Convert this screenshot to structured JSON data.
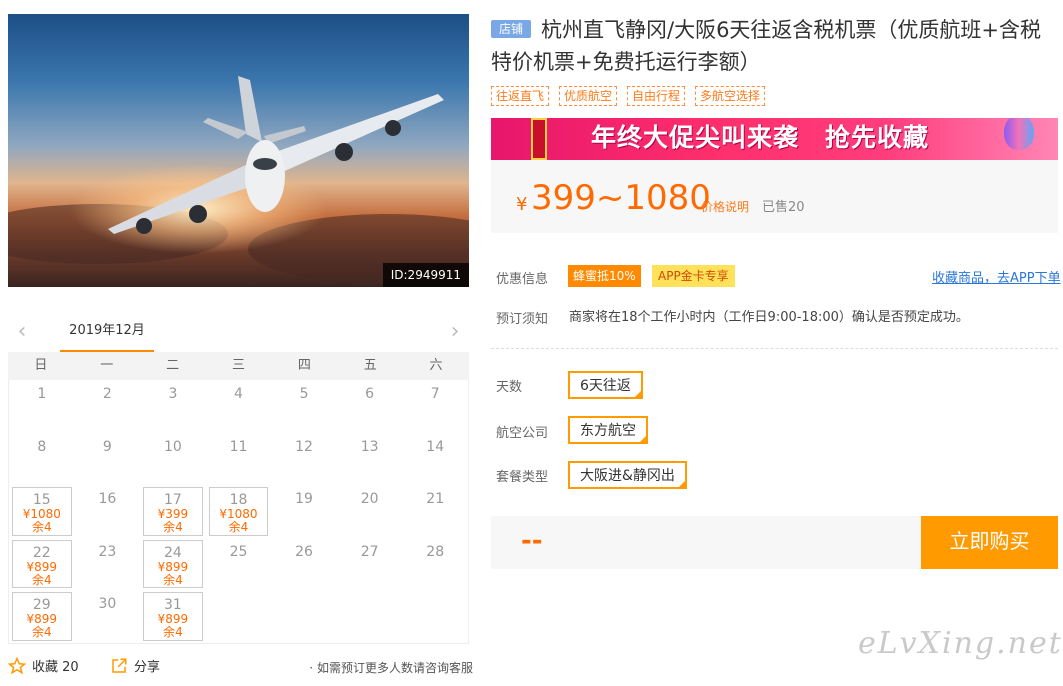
{
  "hero": {
    "id_tag": "ID:2949911"
  },
  "calendar": {
    "month": "2019年12月",
    "prev_icon": "chevron-left-icon",
    "next_icon": "chevron-right-icon",
    "weekdays": [
      "日",
      "一",
      "二",
      "三",
      "四",
      "五",
      "六"
    ],
    "days": [
      {
        "d": "1"
      },
      {
        "d": "2"
      },
      {
        "d": "3"
      },
      {
        "d": "4"
      },
      {
        "d": "5"
      },
      {
        "d": "6"
      },
      {
        "d": "7"
      },
      {
        "d": "8"
      },
      {
        "d": "9"
      },
      {
        "d": "10"
      },
      {
        "d": "11"
      },
      {
        "d": "12"
      },
      {
        "d": "13"
      },
      {
        "d": "14"
      },
      {
        "d": "15",
        "price": "¥1080",
        "rem": "余4"
      },
      {
        "d": "16"
      },
      {
        "d": "17",
        "price": "¥399",
        "rem": "余4"
      },
      {
        "d": "18",
        "price": "¥1080",
        "rem": "余4"
      },
      {
        "d": "19"
      },
      {
        "d": "20"
      },
      {
        "d": "21"
      },
      {
        "d": "22",
        "price": "¥899",
        "rem": "余4"
      },
      {
        "d": "23"
      },
      {
        "d": "24",
        "price": "¥899",
        "rem": "余4"
      },
      {
        "d": "25"
      },
      {
        "d": "26"
      },
      {
        "d": "27"
      },
      {
        "d": "28"
      },
      {
        "d": "29",
        "price": "¥899",
        "rem": "余4"
      },
      {
        "d": "30"
      },
      {
        "d": "31",
        "price": "¥899",
        "rem": "余4"
      }
    ]
  },
  "bottom": {
    "favorite_label": "收藏 20",
    "share_label": "分享",
    "consult_label": "· 如需预订更多人数请咨询客服"
  },
  "product": {
    "shop_tag": "店铺",
    "title": "杭州直飞静冈/大阪6天往返含税机票（优质航班+含税特价机票+免费托运行李额）",
    "labels": [
      "往返直飞",
      "优质航空",
      "自由行程",
      "多航空选择"
    ],
    "banner_text": "年终大促尖叫来袭　抢先收藏",
    "currency": "¥",
    "price": "399~1080",
    "price_note": "价格说明",
    "sold": "已售20"
  },
  "promo": {
    "label": "优惠信息",
    "badge1": "蜂蜜抵10%",
    "badge2": "APP金卡专享",
    "app_link": "收藏商品，去APP下单"
  },
  "booking": {
    "label": "预订须知",
    "text": "商家将在18个工作小时内（工作日9:00-18:00）确认是否预定成功。"
  },
  "options": {
    "days_label": "天数",
    "days_value": "6天往返",
    "airline_label": "航空公司",
    "airline_value": "东方航空",
    "package_label": "套餐类型",
    "package_value": "大阪进&静冈出"
  },
  "buy": {
    "total": "--",
    "button": "立即购买"
  },
  "watermark": "eLvXing.net",
  "colors": {
    "accent": "#ff9a00",
    "price": "#ff6a00",
    "link": "#2b77d8"
  }
}
